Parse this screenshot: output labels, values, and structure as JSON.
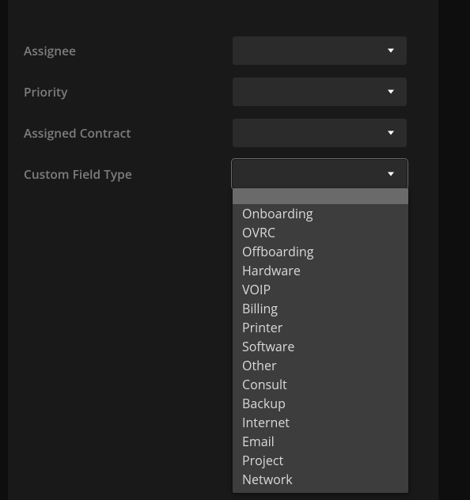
{
  "form": {
    "fields": [
      {
        "label": "Assignee",
        "value": "",
        "name": "assignee-select"
      },
      {
        "label": "Priority",
        "value": "",
        "name": "priority-select"
      },
      {
        "label": "Assigned Contract",
        "value": "",
        "name": "assigned-contract-select"
      },
      {
        "label": "Custom Field Type",
        "value": "",
        "name": "custom-field-type-select",
        "expanded": true
      }
    ]
  },
  "dropdown": {
    "options": [
      "Onboarding",
      "OVRC",
      "Offboarding",
      "Hardware",
      "VOIP",
      "Billing",
      "Printer",
      "Software",
      "Other",
      "Consult",
      "Backup",
      "Internet",
      "Email",
      "Project",
      "Network"
    ]
  },
  "colors": {
    "page_bg": "#0e0e0e",
    "panel_bg": "#191919",
    "select_bg": "#2b2b2b",
    "dropdown_bg": "#3d3d3d",
    "dropdown_header_bg": "#6a6a6a",
    "label": "#7d7d7d",
    "option_text": "#d9d9d9",
    "caret": "#ffffff"
  }
}
